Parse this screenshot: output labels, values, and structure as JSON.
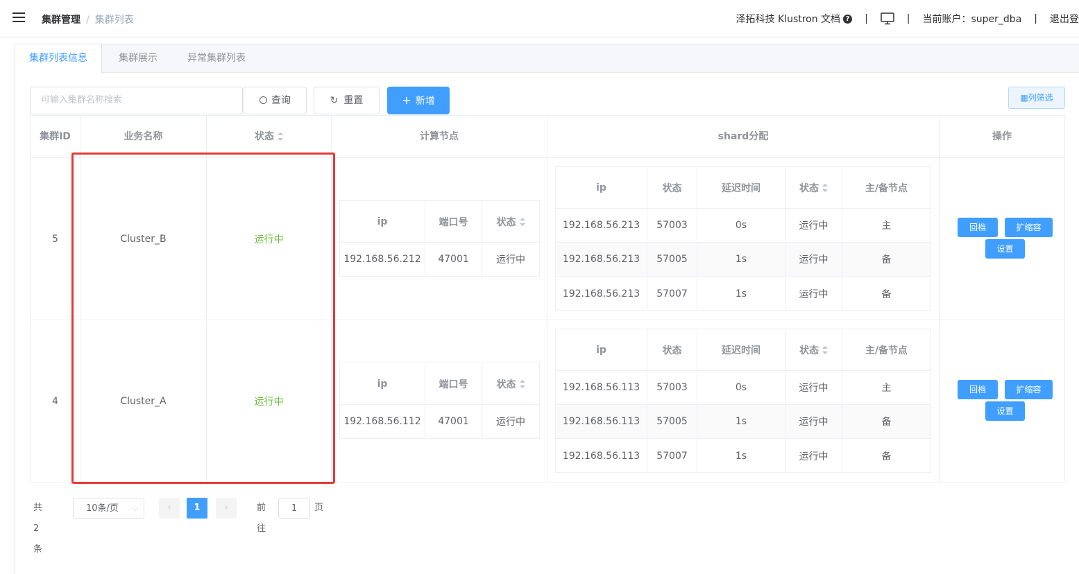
{
  "header": {
    "breadcrumb": [
      "集群管理",
      "集群列表"
    ],
    "docs_link": "泽拓科技 Klustron 文档",
    "account_label": "当前账户：super_dba",
    "logout": "退出登"
  },
  "tabs": [
    "集群列表信息",
    "集群展示",
    "异常集群列表"
  ],
  "search": {
    "placeholder": "可输入集群名称搜索",
    "query_btn": "查询",
    "reset_btn": "重置",
    "add_btn": "新增",
    "filter_btn": "列筛选"
  },
  "table": {
    "headers": {
      "id": "集群ID",
      "name": "业务名称",
      "status": "状态",
      "compute": "计算节点",
      "shard": "shard分配",
      "ops": "操作"
    },
    "compute_headers": [
      "ip",
      "端口号",
      "状态"
    ],
    "shard_headers": [
      "ip",
      "状态",
      "延迟时间",
      "状态",
      "主/备节点"
    ],
    "rows": [
      {
        "id": "5",
        "name": "Cluster_B",
        "status": "运行中",
        "compute": {
          "ip": "192.168.56.212",
          "port": "47001",
          "status": "运行中"
        },
        "shards": [
          {
            "ip": "192.168.56.213",
            "port": "57003",
            "delay": "0s",
            "status": "运行中",
            "role": "主"
          },
          {
            "ip": "192.168.56.213",
            "port": "57005",
            "delay": "1s",
            "status": "运行中",
            "role": "备"
          },
          {
            "ip": "192.168.56.213",
            "port": "57007",
            "delay": "1s",
            "status": "运行中",
            "role": "备"
          }
        ],
        "ops": [
          "回档",
          "扩缩容",
          "设置"
        ]
      },
      {
        "id": "4",
        "name": "Cluster_A",
        "status": "运行中",
        "compute": {
          "ip": "192.168.56.112",
          "port": "47001",
          "status": "运行中"
        },
        "shards": [
          {
            "ip": "192.168.56.113",
            "port": "57003",
            "delay": "0s",
            "status": "运行中",
            "role": "主"
          },
          {
            "ip": "192.168.56.113",
            "port": "57005",
            "delay": "1s",
            "status": "运行中",
            "role": "备"
          },
          {
            "ip": "192.168.56.113",
            "port": "57007",
            "delay": "1s",
            "status": "运行中",
            "role": "备"
          }
        ],
        "ops": [
          "回档",
          "扩缩容",
          "设置"
        ]
      }
    ]
  },
  "pagination": {
    "total": "共 2 条",
    "page_size": "10条/页",
    "current_page": "1",
    "goto_label": "前往",
    "goto_value": "1",
    "page_suffix": "页"
  },
  "colors": {
    "primary": "#409eff",
    "success": "#67c23a",
    "highlight": "#e53935"
  }
}
